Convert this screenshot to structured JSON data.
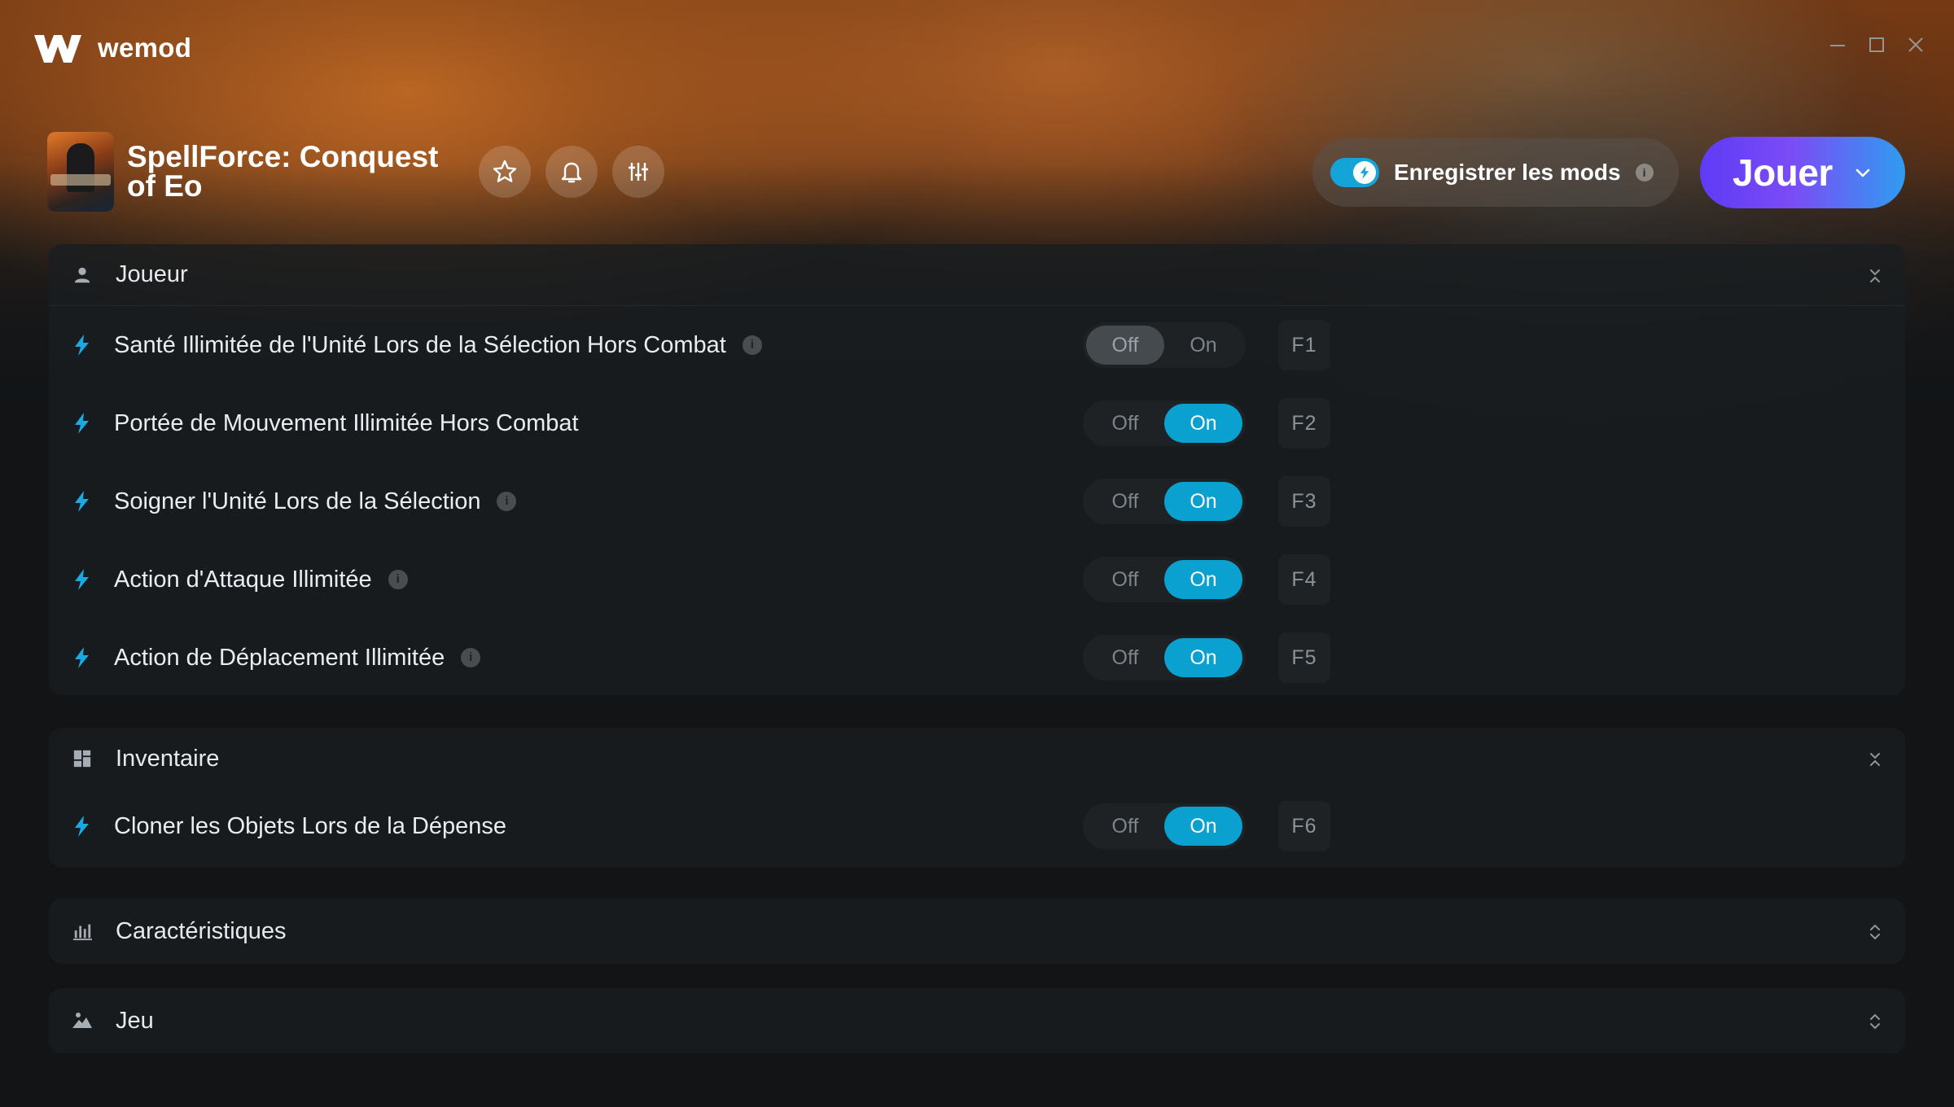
{
  "app": {
    "brand": "wemod"
  },
  "game": {
    "title": "SpellForce: Conquest of Eo"
  },
  "header": {
    "save_mods_label": "Enregistrer les mods",
    "save_mods_info": "i",
    "save_mods_enabled": true,
    "play_label": "Jouer"
  },
  "colors": {
    "accent": "#0aa0d0",
    "play_gradient_start": "#5e3bf5",
    "play_gradient_end": "#2f9cf0"
  },
  "toggle_labels": {
    "off": "Off",
    "on": "On"
  },
  "sections": [
    {
      "title": "Joueur",
      "icon": "person-icon",
      "expanded": true,
      "mods": [
        {
          "label": "Santé Illimitée de l'Unité Lors de la Sélection Hors Combat",
          "info": true,
          "state": "off",
          "hotkey": "F1"
        },
        {
          "label": "Portée de Mouvement Illimitée Hors Combat",
          "info": false,
          "state": "on",
          "hotkey": "F2"
        },
        {
          "label": "Soigner l'Unité Lors de la Sélection",
          "info": true,
          "state": "on",
          "hotkey": "F3"
        },
        {
          "label": "Action d'Attaque Illimitée",
          "info": true,
          "state": "on",
          "hotkey": "F4"
        },
        {
          "label": "Action de Déplacement Illimitée",
          "info": true,
          "state": "on",
          "hotkey": "F5"
        }
      ]
    },
    {
      "title": "Inventaire",
      "icon": "grid-icon",
      "expanded": true,
      "mods": [
        {
          "label": "Cloner les Objets Lors de la Dépense",
          "info": false,
          "state": "on",
          "hotkey": "F6"
        }
      ]
    },
    {
      "title": "Caractéristiques",
      "icon": "bar-chart-icon",
      "expanded": false,
      "mods": []
    },
    {
      "title": "Jeu",
      "icon": "landscape-icon",
      "expanded": false,
      "mods": []
    }
  ]
}
